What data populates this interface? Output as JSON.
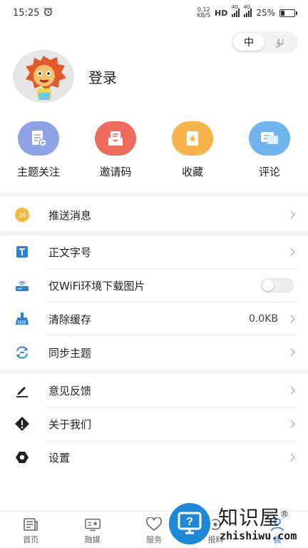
{
  "status_bar": {
    "time": "15:25",
    "net_speed_value": "0.12",
    "net_speed_unit": "KB/S",
    "hd": "HD",
    "signal1": "4G",
    "signal2": "4G",
    "battery_text": "25%",
    "battery_level": 0.25
  },
  "language": {
    "active": "中",
    "inactive": "ئۇ"
  },
  "profile": {
    "login_label": "登录"
  },
  "quick_actions": [
    {
      "label": "主题关注",
      "icon": "topic-follow-icon",
      "color": "#8fa2e6"
    },
    {
      "label": "邀请码",
      "icon": "invite-code-icon",
      "color": "#ee6a5c"
    },
    {
      "label": "收藏",
      "icon": "favorite-icon",
      "color": "#f6b44a"
    },
    {
      "label": "评论",
      "icon": "comment-icon",
      "color": "#6fb3ef"
    }
  ],
  "settings": {
    "push": {
      "label": "推送消息",
      "badge": "24"
    },
    "font_size": {
      "label": "正文字号"
    },
    "wifi_only": {
      "label": "仅WiFi环境下载图片",
      "enabled": false
    },
    "clear_cache": {
      "label": "清除缓存",
      "value": "0.0KB"
    },
    "sync": {
      "label": "同步主题"
    },
    "feedback": {
      "label": "意见反馈"
    },
    "about": {
      "label": "关于我们"
    },
    "settings": {
      "label": "设置"
    }
  },
  "bottom_nav": [
    {
      "label": "首页",
      "icon": "home-icon"
    },
    {
      "label": "融媒",
      "icon": "media-icon"
    },
    {
      "label": "服务",
      "icon": "service-icon"
    },
    {
      "label": "报料",
      "icon": "report-icon"
    },
    {
      "label": "我",
      "icon": "profile-icon"
    }
  ],
  "watermark": {
    "title": "知识屋",
    "registered": "®",
    "subtitle": "zhishiwu.com"
  }
}
